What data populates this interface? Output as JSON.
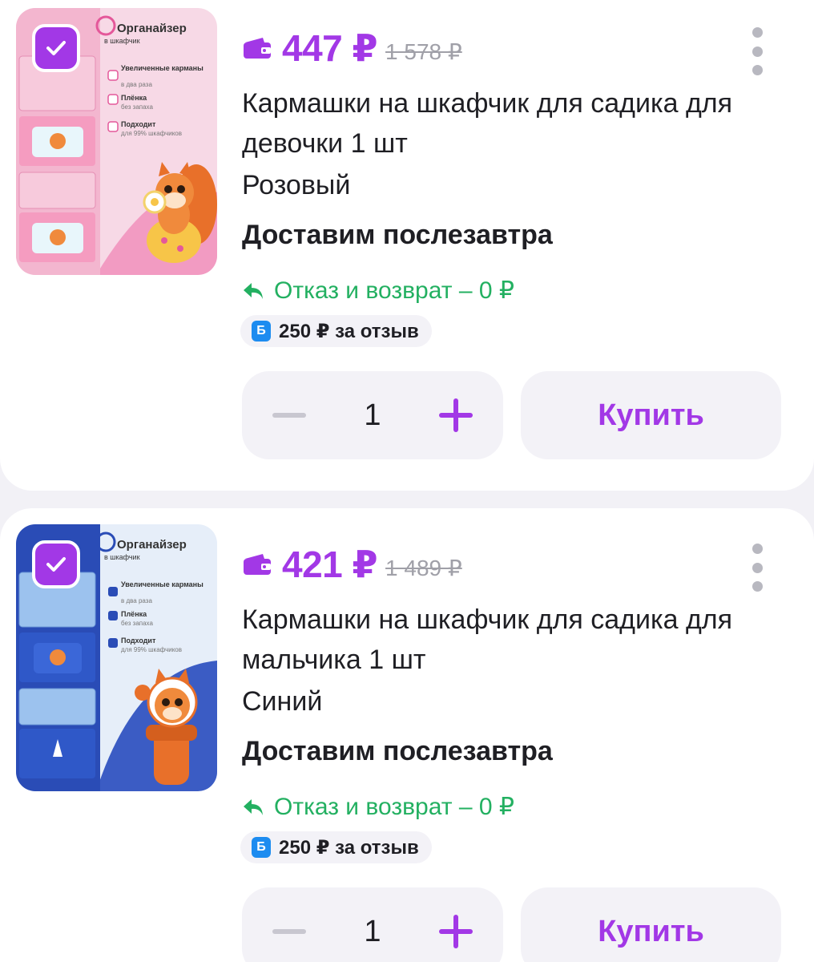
{
  "colors": {
    "accent": "#a238e6",
    "green": "#23b061",
    "badge_blue": "#1d8cf0"
  },
  "items": [
    {
      "image": {
        "brand": "Органайзер",
        "brand_sub": "в шкафчик",
        "features": [
          {
            "title": "Увеличенные карманы",
            "sub": "в два раза"
          },
          {
            "title": "Плёнка",
            "sub": "без запаха"
          },
          {
            "title": "Подходит",
            "sub": "для 99% шкафчиков"
          }
        ],
        "theme": "pink"
      },
      "selected": true,
      "price": "447 ₽",
      "old_price": "1 578 ₽",
      "title": "Кармашки на шкафчик для садика для девочки 1 шт",
      "color": "Розовый",
      "delivery": "Доставим послезавтра",
      "return_text": "Отказ и возврат – 0 ₽",
      "bonus_letter": "Б",
      "bonus_text": "250 ₽ за отзыв",
      "quantity": "1",
      "buy_label": "Купить"
    },
    {
      "image": {
        "brand": "Органайзер",
        "brand_sub": "в шкафчик",
        "features": [
          {
            "title": "Увеличенные карманы",
            "sub": "в два раза"
          },
          {
            "title": "Плёнка",
            "sub": "без запаха"
          },
          {
            "title": "Подходит",
            "sub": "для 99% шкафчиков"
          }
        ],
        "theme": "blue"
      },
      "selected": true,
      "price": "421 ₽",
      "old_price": "1 489 ₽",
      "title": "Кармашки на шкафчик для садика для мальчика 1 шт",
      "color": "Синий",
      "delivery": "Доставим послезавтра",
      "return_text": "Отказ и возврат – 0 ₽",
      "bonus_letter": "Б",
      "bonus_text": "250 ₽ за отзыв",
      "quantity": "1",
      "buy_label": "Купить"
    }
  ]
}
